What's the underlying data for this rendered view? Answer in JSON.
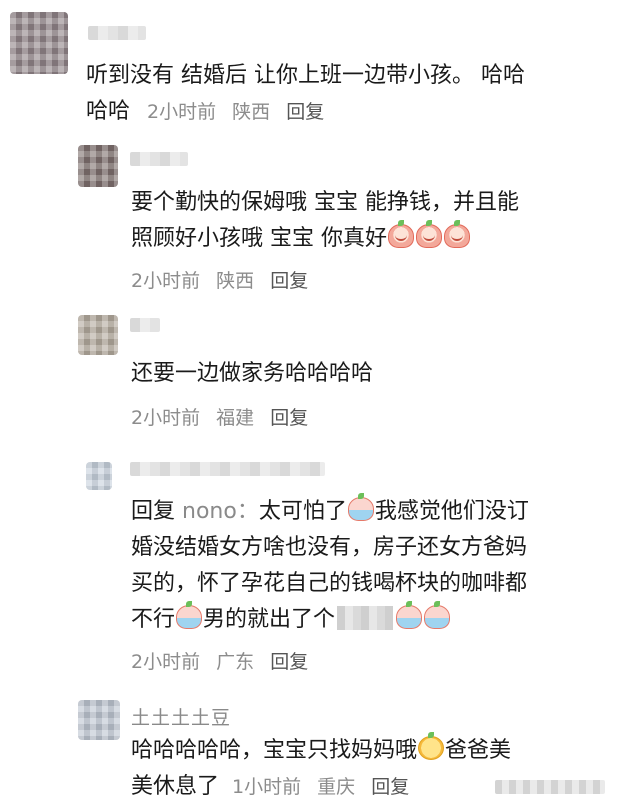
{
  "comments": [
    {
      "text": "听到没有 结婚后 让你上班一边带小孩。 哈哈哈哈",
      "text_line1": "听到没有 结婚后 让你上班一边带小孩。 哈哈",
      "text_line2": "哈哈",
      "time": "2小时前",
      "location": "陕西",
      "reply": "回复"
    },
    {
      "text_line1": "要个勤快的保姆哦 宝宝 能挣钱，并且能",
      "text_line2": "照顾好小孩哦 宝宝 你真好",
      "emojis": [
        "cry-face-icon",
        "cry-face-icon",
        "cry-face-icon"
      ],
      "time": "2小时前",
      "location": "陕西",
      "reply": "回复"
    },
    {
      "text": "还要一边做家务哈哈哈哈",
      "time": "2小时前",
      "location": "福建",
      "reply": "回复"
    },
    {
      "reply_prefix": "回复",
      "reply_to": "nono：",
      "text_a": "太可怕了",
      "text_b": "我感觉他们没订",
      "text_line2": "婚没结婚女方啥也没有，房子还女方爸妈",
      "text_line3": "买的，怀了孕花自己的钱喝杯块的咖啡都",
      "text_line4a": "不行",
      "text_line4b": "男的就出了个",
      "time": "2小时前",
      "location": "广东",
      "reply": "回复"
    },
    {
      "username": "土土土土豆",
      "text_line1a": "哈哈哈哈哈，宝宝只找妈妈哦",
      "text_line1b": "爸爸美",
      "text_line2": "美休息了",
      "time": "1小时前",
      "location": "重庆",
      "reply": "回复"
    }
  ]
}
